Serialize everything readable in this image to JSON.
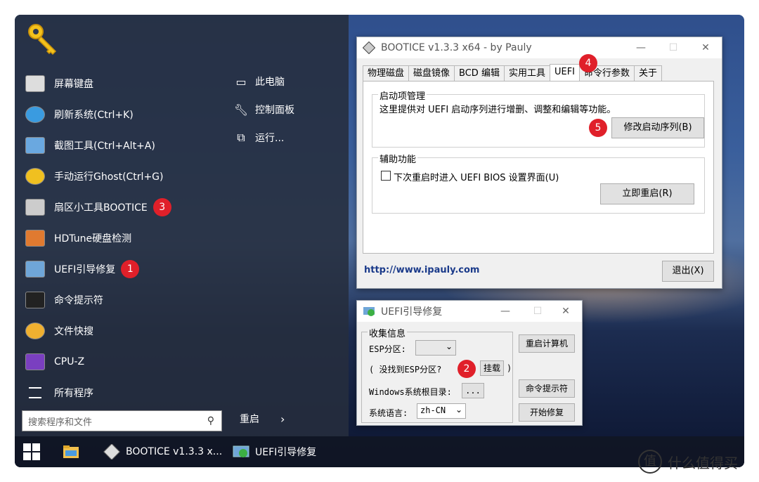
{
  "start_menu": {
    "items": [
      {
        "label": "屏幕键盘",
        "icon": "keyboard-icon"
      },
      {
        "label": "刷新系统(Ctrl+K)",
        "icon": "refresh-icon"
      },
      {
        "label": "截图工具(Ctrl+Alt+A)",
        "icon": "screenshot-icon"
      },
      {
        "label": "手动运行Ghost(Ctrl+G)",
        "icon": "ghost-icon"
      },
      {
        "label": "扇区小工具BOOTICE",
        "icon": "bootice-icon",
        "badge": "3"
      },
      {
        "label": "HDTune硬盘检测",
        "icon": "hdtune-icon"
      },
      {
        "label": "UEFI引导修复",
        "icon": "uefi-repair-icon",
        "badge": "1"
      },
      {
        "label": "命令提示符",
        "icon": "cmd-icon"
      },
      {
        "label": "文件快搜",
        "icon": "file-search-icon"
      },
      {
        "label": "CPU-Z",
        "icon": "cpuz-icon"
      },
      {
        "label": "所有程序",
        "icon": "all-programs-icon"
      }
    ],
    "right_items": [
      {
        "label": "此电脑",
        "icon": "computer-icon"
      },
      {
        "label": "控制面板",
        "icon": "wrench-icon"
      },
      {
        "label": "运行...",
        "icon": "run-icon"
      }
    ],
    "search_placeholder": "搜索程序和文件",
    "restart_label": "重启"
  },
  "taskbar": {
    "items": [
      {
        "label": "",
        "icon": "file-explorer-icon"
      },
      {
        "label": "BOOTICE v1.3.3 x...",
        "icon": "bootice-icon"
      },
      {
        "label": "UEFI引导修复",
        "icon": "uefi-repair-icon"
      }
    ]
  },
  "bootice": {
    "title": "BOOTICE v1.3.3 x64 - by Pauly",
    "tabs": [
      "物理磁盘",
      "磁盘镜像",
      "BCD 编辑",
      "实用工具",
      "UEFI",
      "命令行参数",
      "关于"
    ],
    "active_tab": "UEFI",
    "tab_badge": "4",
    "group1_label": "启动项管理",
    "group1_desc": "这里提供对 UEFI 启动序列进行增删、调整和编辑等功能。",
    "modify_button": "修改启动序列(B)",
    "modify_badge": "5",
    "group2_label": "辅助功能",
    "checkbox_label": "下次重启时进入 UEFI BIOS 设置界面(U)",
    "reboot_button": "立即重启(R)",
    "link": "http://www.ipauly.com",
    "exit_button": "退出(X)"
  },
  "uefi_repair": {
    "title": "UEFI引导修复",
    "group_label": "收集信息",
    "esp_label": "ESP分区:",
    "esp_value": "",
    "notfound_text": "( 没找到ESP分区?",
    "mount_button": "挂载",
    "close_paren": ")",
    "mount_badge": "2",
    "windir_label": "Windows系统根目录:",
    "browse_button": "...",
    "lang_label": "系统语言:",
    "lang_value": "zh-CN",
    "restart_button": "重启计算机",
    "cmd_button": "命令提示符",
    "start_button": "开始修复"
  },
  "watermark": {
    "icon_char": "值",
    "text": "什么值得买"
  }
}
